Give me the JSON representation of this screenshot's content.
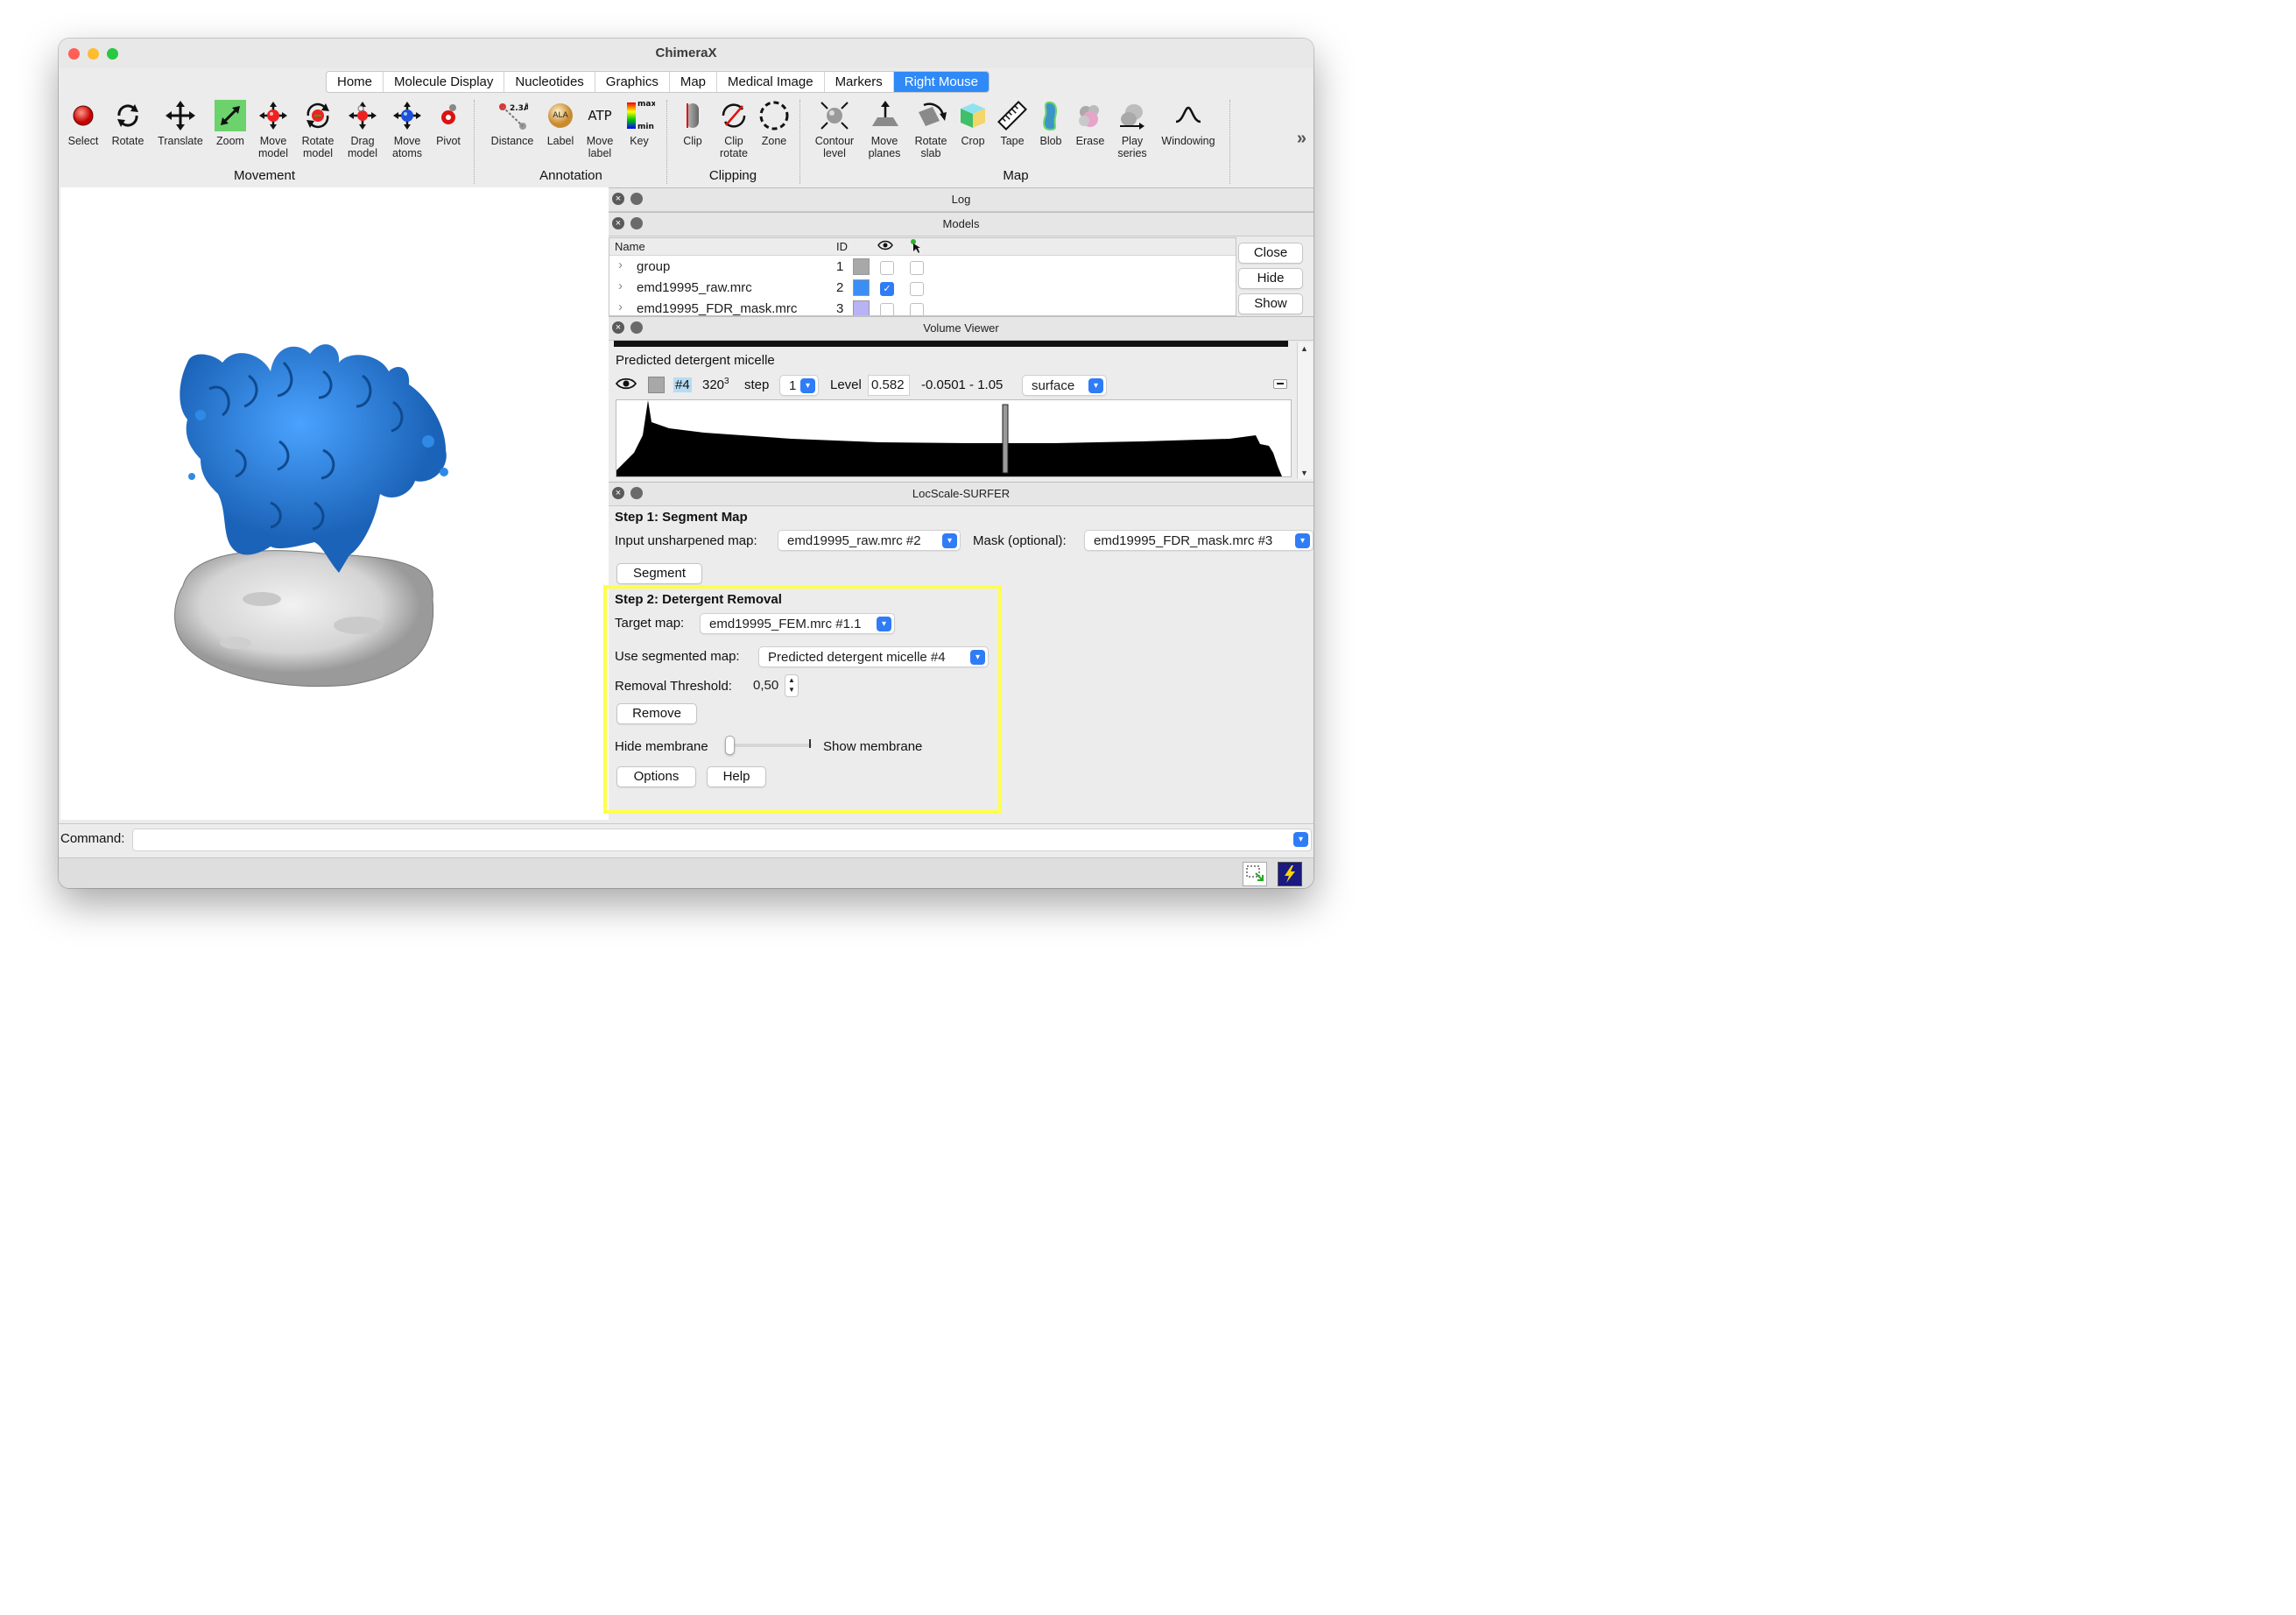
{
  "window": {
    "title": "ChimeraX"
  },
  "tabs": [
    "Home",
    "Molecule Display",
    "Nucleotides",
    "Graphics",
    "Map",
    "Medical Image",
    "Markers",
    "Right Mouse"
  ],
  "active_tab": "Right Mouse",
  "toolbar": {
    "groups": {
      "movement": "Movement",
      "annotation": "Annotation",
      "clipping": "Clipping",
      "map": "Map"
    },
    "tools": {
      "select": "Select",
      "rotate": "Rotate",
      "translate": "Translate",
      "zoom": "Zoom",
      "move_model_1": "Move",
      "move_model_2": "model",
      "rotate_model_1": "Rotate",
      "rotate_model_2": "model",
      "drag_model_1": "Drag",
      "drag_model_2": "model",
      "move_atoms_1": "Move",
      "move_atoms_2": "atoms",
      "pivot": "Pivot",
      "distance": "Distance",
      "distance_icon_text": "2.3Å",
      "label": "Label",
      "label_icon_text": "ALA",
      "move_label_1": "Move",
      "move_label_2": "label",
      "move_label_icon_text": "ATP",
      "key": "Key",
      "key_max": "max",
      "key_min": "min",
      "clip": "Clip",
      "clip_rotate_1": "Clip",
      "clip_rotate_2": "rotate",
      "zone": "Zone",
      "contour_level_1": "Contour",
      "contour_level_2": "level",
      "move_planes_1": "Move",
      "move_planes_2": "planes",
      "rotate_slab_1": "Rotate",
      "rotate_slab_2": "slab",
      "crop": "Crop",
      "tape": "Tape",
      "blob": "Blob",
      "erase": "Erase",
      "play_series_1": "Play",
      "play_series_2": "series",
      "windowing": "Windowing"
    },
    "more_icon": "chevron-double-right"
  },
  "panels": {
    "log": {
      "title": "Log"
    },
    "models": {
      "title": "Models",
      "columns": {
        "name": "Name",
        "id": "ID"
      },
      "rows": [
        {
          "name": "group",
          "id": "1",
          "color": "#a8a8a8",
          "shown": false
        },
        {
          "name": "emd19995_raw.mrc",
          "id": "2",
          "color": "#3a8ef6",
          "shown": true
        },
        {
          "name": "emd19995_FDR_mask.mrc",
          "id": "3",
          "color": "#b7b3f5",
          "shown": false
        }
      ],
      "buttons": {
        "close": "Close",
        "hide": "Hide",
        "show": "Show"
      }
    },
    "volume_viewer": {
      "title": "Volume Viewer",
      "map_name": "Predicted detergent micelle",
      "model_id": "#4",
      "size": "320",
      "size_exp": "3",
      "step_label": "step",
      "step_value": "1",
      "level_label": "Level",
      "level_value": "0.582",
      "range": "-0.0501 - 1.05",
      "style": "surface"
    },
    "locscale": {
      "title": "LocScale-SURFER",
      "step1_title": "Step 1: Segment Map",
      "input_label": "Input unsharpened map:",
      "input_value": "emd19995_raw.mrc #2",
      "mask_label": "Mask (optional):",
      "mask_value": "emd19995_FDR_mask.mrc #3",
      "segment_button": "Segment",
      "step2_title": "Step 2: Detergent Removal",
      "target_label": "Target map:",
      "target_value": "emd19995_FEM.mrc #1.1",
      "segmented_label": "Use segmented map:",
      "segmented_value": "Predicted detergent micelle #4",
      "threshold_label": "Removal Threshold:",
      "threshold_value": "0,50",
      "remove_button": "Remove",
      "hide_membrane": "Hide membrane",
      "show_membrane": "Show membrane",
      "slider_value": 0,
      "options_button": "Options",
      "help_button": "Help"
    }
  },
  "command": {
    "label": "Command:",
    "value": ""
  },
  "colors": {
    "accent": "#2f8af7",
    "highlight": "#ffff4a",
    "protein": "#2a7fd6",
    "micelle": "#d6d6d6"
  }
}
